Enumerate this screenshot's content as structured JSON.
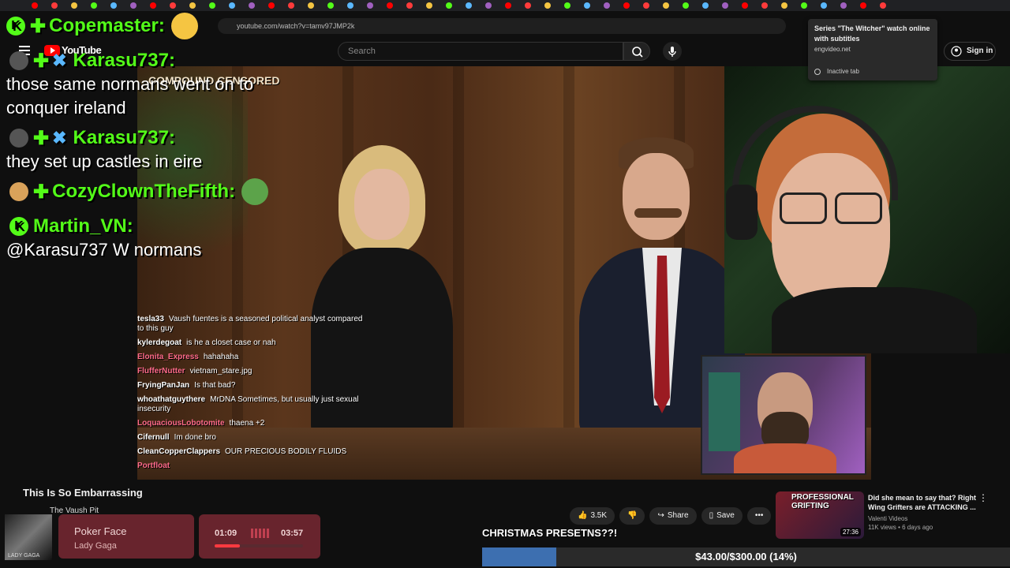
{
  "browser": {
    "url": "youtube.com/watch?v=tamv97JMP2k",
    "tooltip": {
      "title": "Series \"The Witcher\" watch online with subtitles",
      "domain": "engvideo.net",
      "status": "Inactive tab"
    }
  },
  "youtube": {
    "logo_text": "YouTube",
    "search_placeholder": "Search",
    "signin_label": "Sign in",
    "video_title": "This Is So Embarrassing",
    "channel_name": "The Vaush Pit",
    "likes": "3.5K",
    "share_label": "Share",
    "save_label": "Save",
    "overlay_tag": "COMPOUND CENSORED"
  },
  "recommendation": {
    "title": "Did she mean to say that? Right Wing Grifters are ATTACKING ...",
    "channel": "Valenti Videos",
    "meta": "11K views • 6 days ago",
    "duration": "27:36",
    "thumb_text": "PROFESSIONAL GRIFTING"
  },
  "overlay_chat": [
    {
      "user": "Copemaster:",
      "message": ""
    },
    {
      "user": "Karasu737:",
      "message": "those same normans went on to conquer ireland"
    },
    {
      "user": "Karasu737:",
      "message": "they set up castles in eire"
    },
    {
      "user": "CozyClownTheFifth:",
      "message": ""
    },
    {
      "user": "Martin_VN:",
      "message": "@Karasu737 W normans"
    }
  ],
  "mini_chat": [
    {
      "user": "tesla33",
      "message": "Vaush fuentes is a seasoned political analyst compared to this guy",
      "color": "#ffffff"
    },
    {
      "user": "kylerdegoat",
      "message": "is he a closet case or nah",
      "color": "#ffffff"
    },
    {
      "user": "Elonita_Express",
      "message": "hahahaha",
      "color": "#ff6b8a"
    },
    {
      "user": "FlufferNutter",
      "message": "vietnam_stare.jpg",
      "color": "#ff6b8a"
    },
    {
      "user": "FryingPanJan",
      "message": "Is that bad?",
      "color": "#ffffff"
    },
    {
      "user": "whoathatguythere",
      "message": "MrDNA Sometimes, but usually just sexual insecurity",
      "color": "#ffffff"
    },
    {
      "user": "LoquaciousLobotomite",
      "message": "thaena +2",
      "color": "#ff6b8a"
    },
    {
      "user": "Cifernull",
      "message": "Im done bro",
      "color": "#ffffff"
    },
    {
      "user": "CleanCopperClappers",
      "message": "OUR PRECIOUS BODILY FLUIDS",
      "color": "#ffffff"
    },
    {
      "user": "Portfloat",
      "message": "",
      "color": "#ff6b8a"
    }
  ],
  "music": {
    "song": "Poker Face",
    "artist": "Lady Gaga",
    "elapsed": "01:09",
    "total": "03:57",
    "album_text": "LADY GAGA",
    "progress": 0.29
  },
  "goal": {
    "label": "CHRISTMAS PRESETNS??!",
    "text": "$43.00/$300.00 (14%)",
    "fraction": 0.14
  },
  "colors": {
    "kick_green": "#53fc18",
    "youtube_red": "#ff0000",
    "goal_fill": "#3d6fb0"
  }
}
